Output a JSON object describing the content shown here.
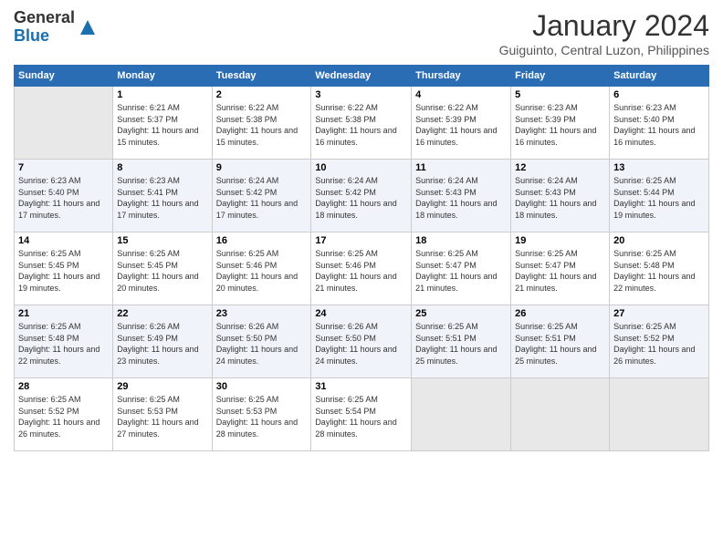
{
  "logo": {
    "general": "General",
    "blue": "Blue"
  },
  "header": {
    "month": "January 2024",
    "location": "Guiguinto, Central Luzon, Philippines"
  },
  "days_of_week": [
    "Sunday",
    "Monday",
    "Tuesday",
    "Wednesday",
    "Thursday",
    "Friday",
    "Saturday"
  ],
  "weeks": [
    [
      {
        "day": "",
        "info": ""
      },
      {
        "day": "1",
        "info": "Sunrise: 6:21 AM\nSunset: 5:37 PM\nDaylight: 11 hours\nand 15 minutes."
      },
      {
        "day": "2",
        "info": "Sunrise: 6:22 AM\nSunset: 5:38 PM\nDaylight: 11 hours\nand 15 minutes."
      },
      {
        "day": "3",
        "info": "Sunrise: 6:22 AM\nSunset: 5:38 PM\nDaylight: 11 hours\nand 16 minutes."
      },
      {
        "day": "4",
        "info": "Sunrise: 6:22 AM\nSunset: 5:39 PM\nDaylight: 11 hours\nand 16 minutes."
      },
      {
        "day": "5",
        "info": "Sunrise: 6:23 AM\nSunset: 5:39 PM\nDaylight: 11 hours\nand 16 minutes."
      },
      {
        "day": "6",
        "info": "Sunrise: 6:23 AM\nSunset: 5:40 PM\nDaylight: 11 hours\nand 16 minutes."
      }
    ],
    [
      {
        "day": "7",
        "info": "Sunrise: 6:23 AM\nSunset: 5:40 PM\nDaylight: 11 hours\nand 17 minutes."
      },
      {
        "day": "8",
        "info": "Sunrise: 6:23 AM\nSunset: 5:41 PM\nDaylight: 11 hours\nand 17 minutes."
      },
      {
        "day": "9",
        "info": "Sunrise: 6:24 AM\nSunset: 5:42 PM\nDaylight: 11 hours\nand 17 minutes."
      },
      {
        "day": "10",
        "info": "Sunrise: 6:24 AM\nSunset: 5:42 PM\nDaylight: 11 hours\nand 18 minutes."
      },
      {
        "day": "11",
        "info": "Sunrise: 6:24 AM\nSunset: 5:43 PM\nDaylight: 11 hours\nand 18 minutes."
      },
      {
        "day": "12",
        "info": "Sunrise: 6:24 AM\nSunset: 5:43 PM\nDaylight: 11 hours\nand 18 minutes."
      },
      {
        "day": "13",
        "info": "Sunrise: 6:25 AM\nSunset: 5:44 PM\nDaylight: 11 hours\nand 19 minutes."
      }
    ],
    [
      {
        "day": "14",
        "info": "Sunrise: 6:25 AM\nSunset: 5:45 PM\nDaylight: 11 hours\nand 19 minutes."
      },
      {
        "day": "15",
        "info": "Sunrise: 6:25 AM\nSunset: 5:45 PM\nDaylight: 11 hours\nand 20 minutes."
      },
      {
        "day": "16",
        "info": "Sunrise: 6:25 AM\nSunset: 5:46 PM\nDaylight: 11 hours\nand 20 minutes."
      },
      {
        "day": "17",
        "info": "Sunrise: 6:25 AM\nSunset: 5:46 PM\nDaylight: 11 hours\nand 21 minutes."
      },
      {
        "day": "18",
        "info": "Sunrise: 6:25 AM\nSunset: 5:47 PM\nDaylight: 11 hours\nand 21 minutes."
      },
      {
        "day": "19",
        "info": "Sunrise: 6:25 AM\nSunset: 5:47 PM\nDaylight: 11 hours\nand 21 minutes."
      },
      {
        "day": "20",
        "info": "Sunrise: 6:25 AM\nSunset: 5:48 PM\nDaylight: 11 hours\nand 22 minutes."
      }
    ],
    [
      {
        "day": "21",
        "info": "Sunrise: 6:25 AM\nSunset: 5:48 PM\nDaylight: 11 hours\nand 22 minutes."
      },
      {
        "day": "22",
        "info": "Sunrise: 6:26 AM\nSunset: 5:49 PM\nDaylight: 11 hours\nand 23 minutes."
      },
      {
        "day": "23",
        "info": "Sunrise: 6:26 AM\nSunset: 5:50 PM\nDaylight: 11 hours\nand 24 minutes."
      },
      {
        "day": "24",
        "info": "Sunrise: 6:26 AM\nSunset: 5:50 PM\nDaylight: 11 hours\nand 24 minutes."
      },
      {
        "day": "25",
        "info": "Sunrise: 6:25 AM\nSunset: 5:51 PM\nDaylight: 11 hours\nand 25 minutes."
      },
      {
        "day": "26",
        "info": "Sunrise: 6:25 AM\nSunset: 5:51 PM\nDaylight: 11 hours\nand 25 minutes."
      },
      {
        "day": "27",
        "info": "Sunrise: 6:25 AM\nSunset: 5:52 PM\nDaylight: 11 hours\nand 26 minutes."
      }
    ],
    [
      {
        "day": "28",
        "info": "Sunrise: 6:25 AM\nSunset: 5:52 PM\nDaylight: 11 hours\nand 26 minutes."
      },
      {
        "day": "29",
        "info": "Sunrise: 6:25 AM\nSunset: 5:53 PM\nDaylight: 11 hours\nand 27 minutes."
      },
      {
        "day": "30",
        "info": "Sunrise: 6:25 AM\nSunset: 5:53 PM\nDaylight: 11 hours\nand 28 minutes."
      },
      {
        "day": "31",
        "info": "Sunrise: 6:25 AM\nSunset: 5:54 PM\nDaylight: 11 hours\nand 28 minutes."
      },
      {
        "day": "",
        "info": ""
      },
      {
        "day": "",
        "info": ""
      },
      {
        "day": "",
        "info": ""
      }
    ]
  ]
}
